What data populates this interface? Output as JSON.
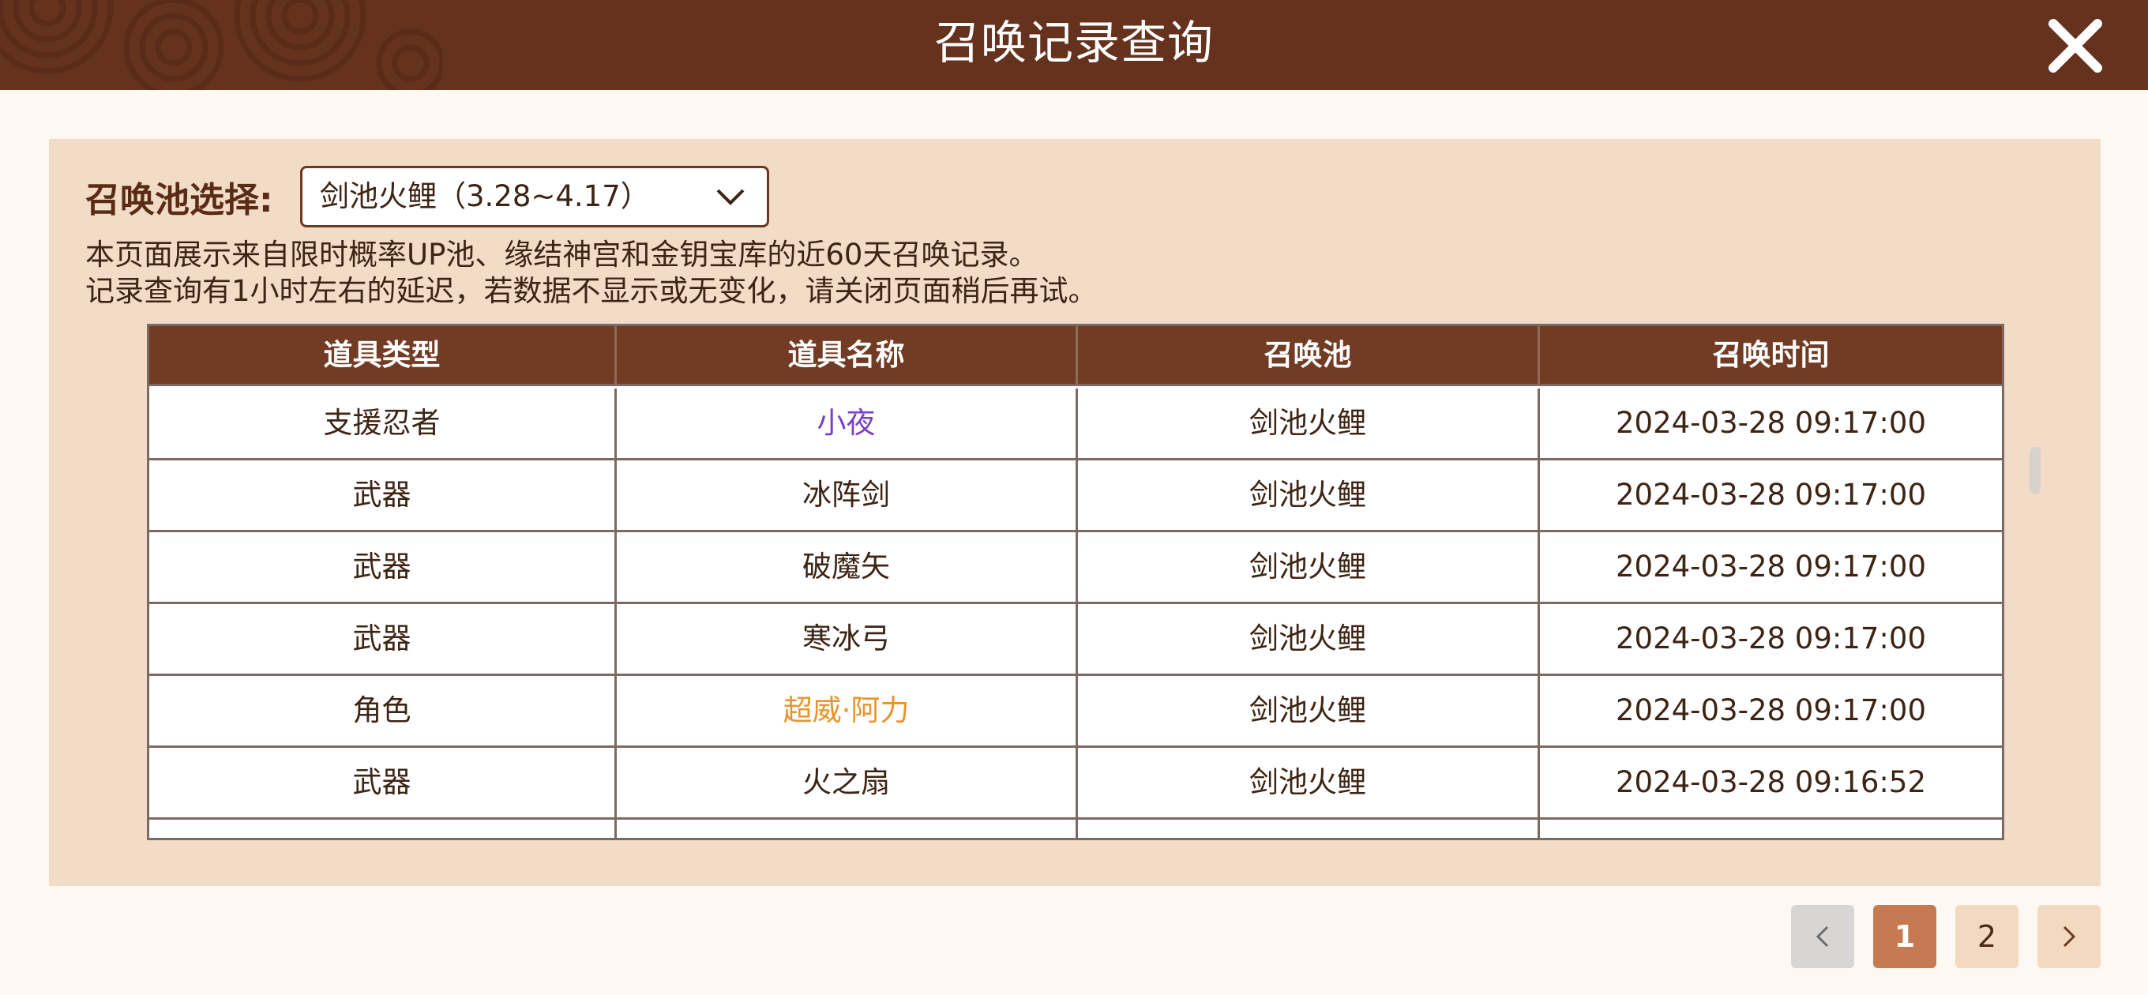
{
  "header": {
    "title": "召唤记录查询",
    "close_icon": "close-icon"
  },
  "filter": {
    "label": "召唤池选择:",
    "selected_pool": "剑池火鲤（3.28~4.17）",
    "dropdown_icon": "chevron-down-icon"
  },
  "notice": {
    "line1": "本页面展示来自限时概率UP池、缘结神宫和金钥宝库的近60天召唤记录。",
    "line2": "记录查询有1小时左右的延迟，若数据不显示或无变化，请关闭页面稍后再试。"
  },
  "table": {
    "columns": [
      "道具类型",
      "道具名称",
      "召唤池",
      "召唤时间"
    ],
    "rows": [
      {
        "type": "支援忍者",
        "name": "小夜",
        "pool": "剑池火鲤",
        "time": "2024-03-28 09:17:00",
        "rarity_color": "#7b40c8"
      },
      {
        "type": "武器",
        "name": "冰阵剑",
        "pool": "剑池火鲤",
        "time": "2024-03-28 09:17:00",
        "rarity_color": ""
      },
      {
        "type": "武器",
        "name": "破魔矢",
        "pool": "剑池火鲤",
        "time": "2024-03-28 09:17:00",
        "rarity_color": ""
      },
      {
        "type": "武器",
        "name": "寒冰弓",
        "pool": "剑池火鲤",
        "time": "2024-03-28 09:17:00",
        "rarity_color": ""
      },
      {
        "type": "角色",
        "name": "超威·阿力",
        "pool": "剑池火鲤",
        "time": "2024-03-28 09:17:00",
        "rarity_color": "#e8942a"
      },
      {
        "type": "武器",
        "name": "火之扇",
        "pool": "剑池火鲤",
        "time": "2024-03-28 09:16:52",
        "rarity_color": ""
      }
    ]
  },
  "pagination": {
    "prev_icon": "chevron-left-icon",
    "pages": [
      "1",
      "2"
    ],
    "current_page": "1",
    "next_icon": "chevron-right-icon"
  },
  "colors": {
    "header_bg": "#65321e",
    "panel_bg": "#f2dcc8",
    "table_header_bg": "#723b24",
    "active_page_bg": "#c67a52"
  }
}
